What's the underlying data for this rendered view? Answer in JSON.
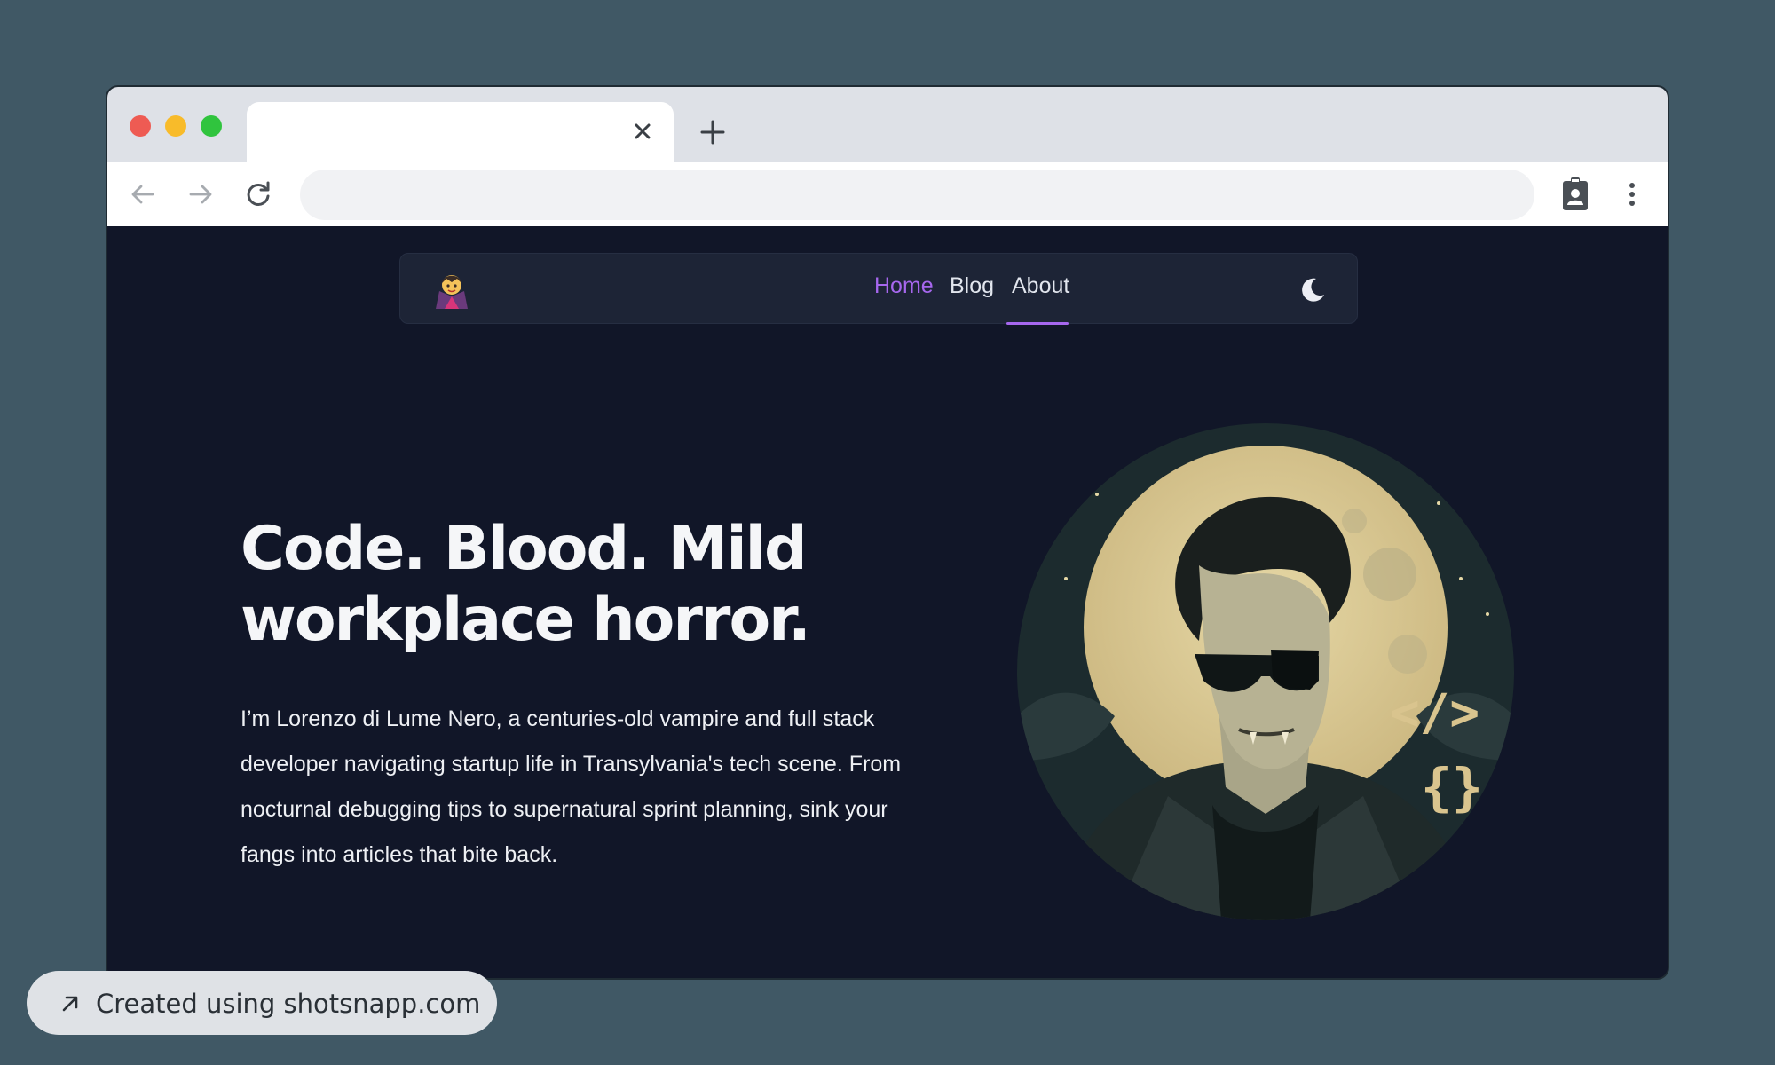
{
  "browser": {
    "tab_title": "",
    "address": "",
    "address_placeholder": ""
  },
  "nav": {
    "logo_icon": "vampire-emoji-icon",
    "links": [
      "Home",
      "Blog",
      "About"
    ],
    "active": "Home",
    "theme_toggle_icon": "moon-icon"
  },
  "hero": {
    "headline_line1": "Code. Blood. Mild",
    "headline_line2": "workplace horror.",
    "intro": "I’m Lorenzo di Lume Nero, a centuries-old vampire and full stack developer navigating startup life in Transylvania's tech scene. From nocturnal debugging tips to supernatural sprint planning, sink your fangs into articles that bite back.",
    "portrait_symbols": [
      "</>",
      "{}"
    ]
  },
  "badge": {
    "text": "Created using shotsnapp.com"
  },
  "colors": {
    "page_background": "#405865",
    "site_background": "#111628",
    "navbar_background": "#1d2436",
    "accent": "#a667ee",
    "moon_gold": "#dac995"
  }
}
